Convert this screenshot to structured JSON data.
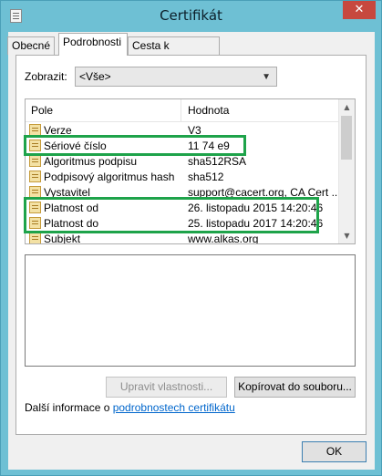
{
  "window": {
    "title": "Certifikát",
    "close_glyph": "✕"
  },
  "tabs": [
    {
      "label": "Obecné"
    },
    {
      "label": "Podrobnosti"
    },
    {
      "label": "Cesta k certifikátu"
    }
  ],
  "show": {
    "label": "Zobrazit:",
    "value": "<Vše>"
  },
  "list": {
    "headers": {
      "field": "Pole",
      "value": "Hodnota"
    },
    "rows": [
      {
        "name": "Verze",
        "value": "V3"
      },
      {
        "name": "Sériové číslo",
        "value": "11 74 e9"
      },
      {
        "name": "Algoritmus podpisu",
        "value": "sha512RSA"
      },
      {
        "name": "Podpisový algoritmus hash",
        "value": "sha512"
      },
      {
        "name": "Vystavitel",
        "value": "support@cacert.org, CA Cert ..."
      },
      {
        "name": "Platnost od",
        "value": "26. listopadu 2015 14:20:46"
      },
      {
        "name": "Platnost do",
        "value": "25. listopadu 2017 14:20:46"
      },
      {
        "name": "Subjekt",
        "value": "www.alkas.org"
      }
    ]
  },
  "buttons": {
    "edit": "Upravit vlastnosti...",
    "copy": "Kopírovat do souboru...",
    "ok": "OK"
  },
  "info": {
    "prefix": "Další informace o ",
    "link": "podrobnostech certifikátu"
  },
  "colors": {
    "highlight": "#1ea34a",
    "accent": "#6ec0d4"
  }
}
